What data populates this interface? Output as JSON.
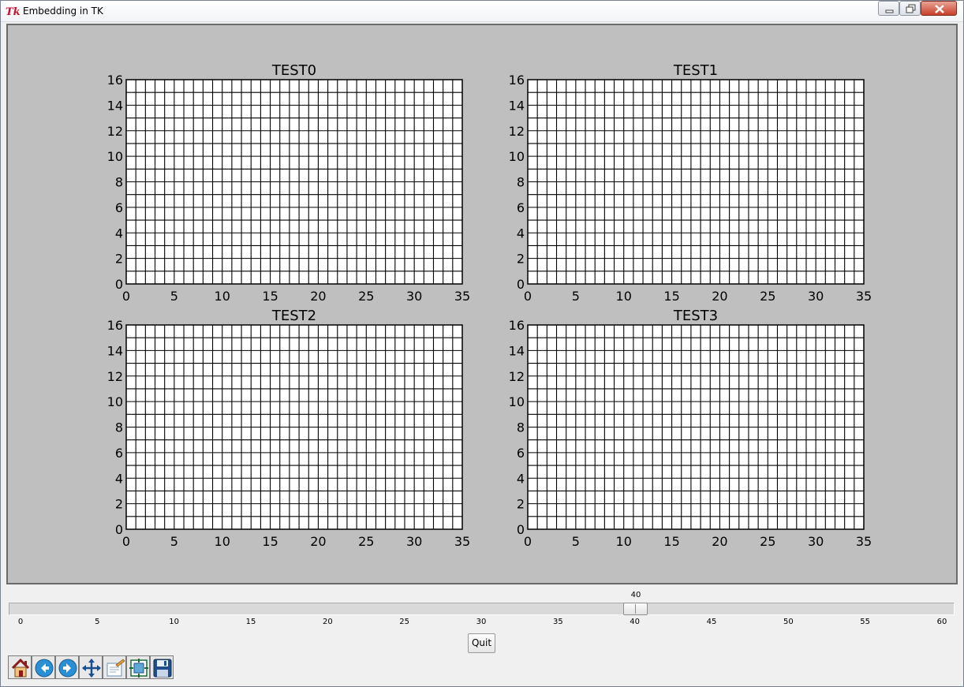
{
  "window": {
    "title": "Embedding in TK"
  },
  "chart_data": [
    {
      "type": "line",
      "title": "TEST0",
      "xlim": [
        0,
        35
      ],
      "ylim": [
        0,
        16
      ],
      "xticks": [
        0,
        5,
        10,
        15,
        20,
        25,
        30,
        35
      ],
      "yticks": [
        0,
        2,
        4,
        6,
        8,
        10,
        12,
        14,
        16
      ],
      "grid": true,
      "grid_x_step": 1,
      "grid_y_step": 1,
      "series": []
    },
    {
      "type": "line",
      "title": "TEST1",
      "xlim": [
        0,
        35
      ],
      "ylim": [
        0,
        16
      ],
      "xticks": [
        0,
        5,
        10,
        15,
        20,
        25,
        30,
        35
      ],
      "yticks": [
        0,
        2,
        4,
        6,
        8,
        10,
        12,
        14,
        16
      ],
      "grid": true,
      "grid_x_step": 1,
      "grid_y_step": 1,
      "series": []
    },
    {
      "type": "line",
      "title": "TEST2",
      "xlim": [
        0,
        35
      ],
      "ylim": [
        0,
        16
      ],
      "xticks": [
        0,
        5,
        10,
        15,
        20,
        25,
        30,
        35
      ],
      "yticks": [
        0,
        2,
        4,
        6,
        8,
        10,
        12,
        14,
        16
      ],
      "grid": true,
      "grid_x_step": 1,
      "grid_y_step": 1,
      "series": []
    },
    {
      "type": "line",
      "title": "TEST3",
      "xlim": [
        0,
        35
      ],
      "ylim": [
        0,
        16
      ],
      "xticks": [
        0,
        5,
        10,
        15,
        20,
        25,
        30,
        35
      ],
      "yticks": [
        0,
        2,
        4,
        6,
        8,
        10,
        12,
        14,
        16
      ],
      "grid": true,
      "grid_x_step": 1,
      "grid_y_step": 1,
      "series": []
    }
  ],
  "slider": {
    "value": 40,
    "value_label": "40",
    "min": 0,
    "max": 60,
    "ticks": [
      "0",
      "5",
      "10",
      "15",
      "20",
      "25",
      "30",
      "35",
      "40",
      "45",
      "50",
      "55",
      "60"
    ]
  },
  "quit_button": {
    "label": "Quit"
  },
  "toolbar": {
    "items": [
      {
        "icon": "home-icon",
        "name": "home"
      },
      {
        "icon": "back-icon",
        "name": "back"
      },
      {
        "icon": "forward-icon",
        "name": "forward"
      },
      {
        "icon": "pan-icon",
        "name": "pan"
      },
      {
        "icon": "zoom-icon",
        "name": "zoom"
      },
      {
        "icon": "subplots-icon",
        "name": "configure-subplots"
      },
      {
        "icon": "save-icon",
        "name": "save"
      }
    ]
  }
}
